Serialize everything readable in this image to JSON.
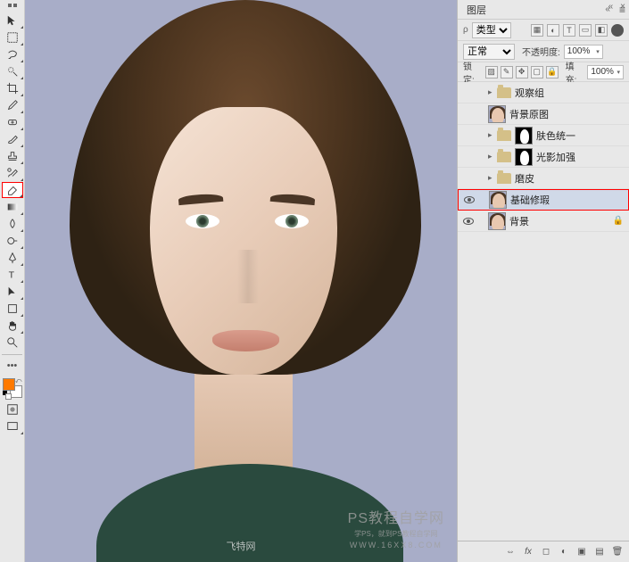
{
  "panel": {
    "title": "图层",
    "type_label": "类型",
    "blend_mode": "正常",
    "opacity_label": "不透明度:",
    "opacity_value": "100%",
    "lock_label": "锁定:",
    "fill_label": "填充:",
    "fill_value": "100%"
  },
  "layers": [
    {
      "name": "观察组",
      "kind": "group",
      "visible": false,
      "indent": 0
    },
    {
      "name": "背景原图",
      "kind": "image",
      "visible": false,
      "indent": 0
    },
    {
      "name": "肤色统一",
      "kind": "group_masked",
      "visible": false,
      "indent": 0
    },
    {
      "name": "光影加强",
      "kind": "group_masked",
      "visible": false,
      "indent": 0
    },
    {
      "name": "磨皮",
      "kind": "group",
      "visible": false,
      "indent": 0
    },
    {
      "name": "基础修瑕",
      "kind": "image",
      "visible": true,
      "indent": 0,
      "selected": true
    },
    {
      "name": "背景",
      "kind": "image",
      "visible": true,
      "indent": 0,
      "locked": true
    }
  ],
  "watermark": {
    "center": "飞特网",
    "title": "PS教程自学网",
    "sub": "学PS，就到PS教程自学网",
    "url": "WWW.16XX8.COM"
  },
  "colors": {
    "foreground": "#ff7a00",
    "background": "#ffffff"
  },
  "footer_icons": [
    "link",
    "fx",
    "mask",
    "adjust",
    "group",
    "new",
    "trash"
  ]
}
